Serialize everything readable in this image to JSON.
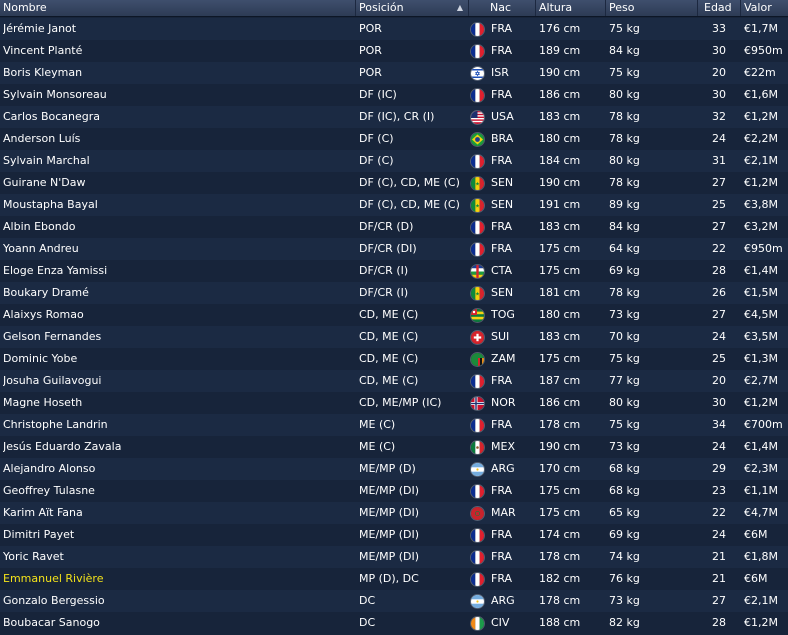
{
  "headers": {
    "name": "Nombre",
    "position": "Posición",
    "nat": "Nac",
    "height": "Altura",
    "weight": "Peso",
    "age": "Edad",
    "value": "Valor",
    "sort_indicator": "▲"
  },
  "players": [
    {
      "name": "Jérémie Janot",
      "position": "POR",
      "flag": "FRA",
      "nat": "FRA",
      "height": "176 cm",
      "weight": "75 kg",
      "age": "33",
      "value": "€1,7M"
    },
    {
      "name": "Vincent Planté",
      "position": "POR",
      "flag": "FRA",
      "nat": "FRA",
      "height": "189 cm",
      "weight": "84 kg",
      "age": "30",
      "value": "€950m"
    },
    {
      "name": "Boris Kleyman",
      "position": "POR",
      "flag": "ISR",
      "nat": "ISR",
      "height": "190 cm",
      "weight": "75 kg",
      "age": "20",
      "value": "€22m"
    },
    {
      "name": "Sylvain Monsoreau",
      "position": "DF (IC)",
      "flag": "FRA",
      "nat": "FRA",
      "height": "186 cm",
      "weight": "80 kg",
      "age": "30",
      "value": "€1,6M"
    },
    {
      "name": "Carlos Bocanegra",
      "position": "DF (IC), CR (I)",
      "flag": "USA",
      "nat": "USA",
      "height": "183 cm",
      "weight": "78 kg",
      "age": "32",
      "value": "€1,2M"
    },
    {
      "name": "Anderson Luís",
      "position": "DF (C)",
      "flag": "BRA",
      "nat": "BRA",
      "height": "180 cm",
      "weight": "78 kg",
      "age": "24",
      "value": "€2,2M"
    },
    {
      "name": "Sylvain Marchal",
      "position": "DF (C)",
      "flag": "FRA",
      "nat": "FRA",
      "height": "184 cm",
      "weight": "80 kg",
      "age": "31",
      "value": "€2,1M"
    },
    {
      "name": "Guirane N'Daw",
      "position": "DF (C), CD, ME (C)",
      "flag": "SEN",
      "nat": "SEN",
      "height": "190 cm",
      "weight": "78 kg",
      "age": "27",
      "value": "€1,2M"
    },
    {
      "name": "Moustapha Bayal",
      "position": "DF (C), CD, ME (C)",
      "flag": "SEN",
      "nat": "SEN",
      "height": "191 cm",
      "weight": "89 kg",
      "age": "25",
      "value": "€3,8M"
    },
    {
      "name": "Albin Ebondo",
      "position": "DF/CR (D)",
      "flag": "FRA",
      "nat": "FRA",
      "height": "183 cm",
      "weight": "84 kg",
      "age": "27",
      "value": "€3,2M"
    },
    {
      "name": "Yoann Andreu",
      "position": "DF/CR (DI)",
      "flag": "FRA",
      "nat": "FRA",
      "height": "175 cm",
      "weight": "64 kg",
      "age": "22",
      "value": "€950m"
    },
    {
      "name": "Eloge Enza Yamissi",
      "position": "DF/CR (I)",
      "flag": "CTA",
      "nat": "CTA",
      "height": "175 cm",
      "weight": "69 kg",
      "age": "28",
      "value": "€1,4M"
    },
    {
      "name": "Boukary Dramé",
      "position": "DF/CR (I)",
      "flag": "SEN",
      "nat": "SEN",
      "height": "181 cm",
      "weight": "78 kg",
      "age": "26",
      "value": "€1,5M"
    },
    {
      "name": "Alaixys Romao",
      "position": "CD, ME (C)",
      "flag": "TOG",
      "nat": "TOG",
      "height": "180 cm",
      "weight": "73 kg",
      "age": "27",
      "value": "€4,5M"
    },
    {
      "name": "Gelson Fernandes",
      "position": "CD, ME (C)",
      "flag": "SUI",
      "nat": "SUI",
      "height": "183 cm",
      "weight": "70 kg",
      "age": "24",
      "value": "€3,5M"
    },
    {
      "name": "Dominic Yobe",
      "position": "CD, ME (C)",
      "flag": "ZAM",
      "nat": "ZAM",
      "height": "175 cm",
      "weight": "75 kg",
      "age": "25",
      "value": "€1,3M"
    },
    {
      "name": "Josuha Guilavogui",
      "position": "CD, ME (C)",
      "flag": "FRA",
      "nat": "FRA",
      "height": "187 cm",
      "weight": "77 kg",
      "age": "20",
      "value": "€2,7M"
    },
    {
      "name": "Magne Hoseth",
      "position": "CD, ME/MP (IC)",
      "flag": "NOR",
      "nat": "NOR",
      "height": "186 cm",
      "weight": "80 kg",
      "age": "30",
      "value": "€1,2M"
    },
    {
      "name": "Christophe Landrin",
      "position": "ME (C)",
      "flag": "FRA",
      "nat": "FRA",
      "height": "178 cm",
      "weight": "75 kg",
      "age": "34",
      "value": "€700m"
    },
    {
      "name": "Jesús Eduardo Zavala",
      "position": "ME (C)",
      "flag": "MEX",
      "nat": "MEX",
      "height": "190 cm",
      "weight": "73 kg",
      "age": "24",
      "value": "€1,4M"
    },
    {
      "name": "Alejandro Alonso",
      "position": "ME/MP (D)",
      "flag": "ARG",
      "nat": "ARG",
      "height": "170 cm",
      "weight": "68 kg",
      "age": "29",
      "value": "€2,3M"
    },
    {
      "name": "Geoffrey Tulasne",
      "position": "ME/MP (DI)",
      "flag": "FRA",
      "nat": "FRA",
      "height": "175 cm",
      "weight": "68 kg",
      "age": "23",
      "value": "€1,1M"
    },
    {
      "name": "Karim Aït Fana",
      "position": "ME/MP (DI)",
      "flag": "MAR",
      "nat": "MAR",
      "height": "175 cm",
      "weight": "65 kg",
      "age": "22",
      "value": "€4,7M"
    },
    {
      "name": "Dimitri Payet",
      "position": "ME/MP (DI)",
      "flag": "FRA",
      "nat": "FRA",
      "height": "174 cm",
      "weight": "69 kg",
      "age": "24",
      "value": "€6M"
    },
    {
      "name": "Yoric Ravet",
      "position": "ME/MP (DI)",
      "flag": "FRA",
      "nat": "FRA",
      "height": "178 cm",
      "weight": "74 kg",
      "age": "21",
      "value": "€1,8M"
    },
    {
      "name": "Emmanuel Rivière",
      "position": "MP (D), DC",
      "flag": "FRA",
      "nat": "FRA",
      "height": "182 cm",
      "weight": "76 kg",
      "age": "21",
      "value": "€6M",
      "highlight": true
    },
    {
      "name": "Gonzalo Bergessio",
      "position": "DC",
      "flag": "ARG",
      "nat": "ARG",
      "height": "178 cm",
      "weight": "73 kg",
      "age": "27",
      "value": "€2,1M"
    },
    {
      "name": "Boubacar Sanogo",
      "position": "DC",
      "flag": "CIV",
      "nat": "CIV",
      "height": "188 cm",
      "weight": "82 kg",
      "age": "28",
      "value": "€1,2M"
    }
  ],
  "colors": {
    "background": "#17243a",
    "row_alt": "#1b2a43",
    "header": "#354560",
    "highlight_name": "#f3e21a"
  }
}
